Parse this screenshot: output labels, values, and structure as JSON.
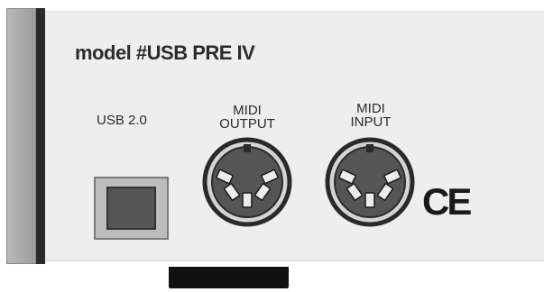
{
  "panel": {
    "model_text": "model  #USB PRE  IV",
    "ports": {
      "usb_label": "USB 2.0",
      "midi_output_line1": "MIDI",
      "midi_output_line2": "OUTPUT",
      "midi_input_line1": "MIDI",
      "midi_input_line2": "INPUT"
    },
    "certification_mark": "CE"
  },
  "icons": {
    "usb": "usb-b-port-icon",
    "midi_out": "din-5-connector-icon",
    "midi_in": "din-5-connector-icon"
  },
  "colors": {
    "panel": "#eeeeee",
    "bracket": "#a9a9a9",
    "dark": "#111111",
    "text": "#2b2b2b"
  }
}
